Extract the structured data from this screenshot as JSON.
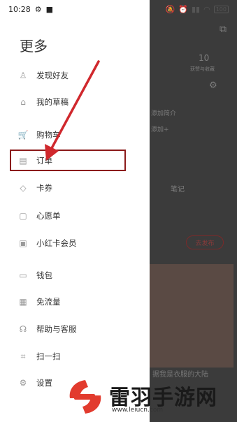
{
  "status": {
    "time": "10:28",
    "battery": "100"
  },
  "drawer": {
    "title": "更多",
    "items": [
      {
        "label": "发现好友",
        "icon": "person-icon"
      },
      {
        "label": "我的草稿",
        "icon": "draft-box-icon"
      },
      {
        "label": "购物车",
        "icon": "cart-icon"
      },
      {
        "label": "订单",
        "icon": "order-icon"
      },
      {
        "label": "卡券",
        "icon": "coupon-tag-icon"
      },
      {
        "label": "心愿单",
        "icon": "wishlist-icon"
      },
      {
        "label": "小红卡会员",
        "icon": "member-card-icon"
      },
      {
        "label": "钱包",
        "icon": "wallet-icon"
      },
      {
        "label": "免流量",
        "icon": "data-free-icon"
      },
      {
        "label": "帮助与客服",
        "icon": "headset-icon"
      },
      {
        "label": "扫一扫",
        "icon": "scan-icon"
      },
      {
        "label": "设置",
        "icon": "gear-icon"
      }
    ]
  },
  "background": {
    "count": "10",
    "count_label": "获赞与收藏",
    "line1": "添加简介",
    "line2": "添加+",
    "section": "笔记",
    "button": "去发布",
    "caption": "据我是衣服的大陆"
  },
  "watermark": {
    "name": "雷羽手游网",
    "url": "www.leiucn.com"
  },
  "colors": {
    "highlight": "#8b1a1a",
    "arrow": "#d0282d"
  }
}
